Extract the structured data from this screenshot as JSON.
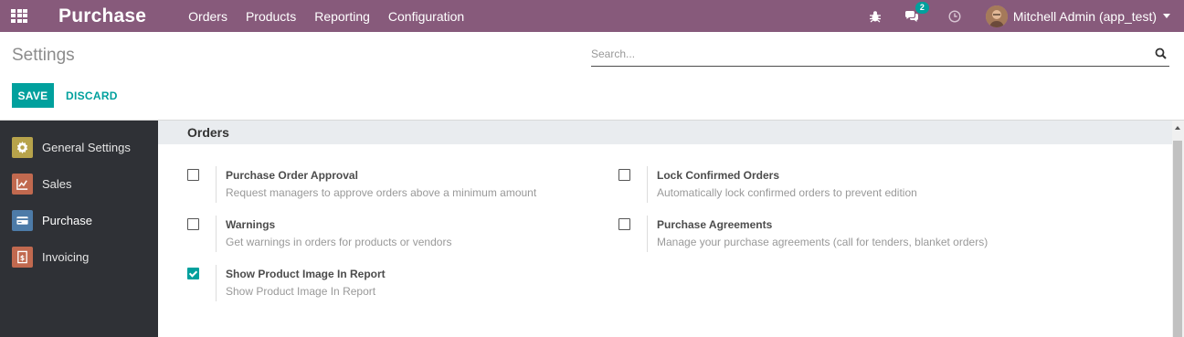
{
  "navbar": {
    "app_title": "Purchase",
    "menu": [
      "Orders",
      "Products",
      "Reporting",
      "Configuration"
    ],
    "chat_count": "2",
    "user_name": "Mitchell Admin (app_test)"
  },
  "control_panel": {
    "title": "Settings",
    "search_placeholder": "Search...",
    "save_label": "SAVE",
    "discard_label": "DISCARD"
  },
  "sidebar": {
    "items": [
      {
        "label": "General Settings",
        "icon": "gear-icon",
        "color": "#b7a34b"
      },
      {
        "label": "Sales",
        "icon": "sales-chart-icon",
        "color": "#c1694f"
      },
      {
        "label": "Purchase",
        "icon": "purchase-card-icon",
        "color": "#4d7ba8"
      },
      {
        "label": "Invoicing",
        "icon": "invoice-icon",
        "color": "#c1694f"
      }
    ],
    "active": "Purchase"
  },
  "section": {
    "title": "Orders",
    "settings": [
      {
        "title": "Purchase Order Approval",
        "description": "Request managers to approve orders above a minimum amount",
        "checked": false
      },
      {
        "title": "Lock Confirmed Orders",
        "description": "Automatically lock confirmed orders to prevent edition",
        "checked": false
      },
      {
        "title": "Warnings",
        "description": "Get warnings in orders for products or vendors",
        "checked": false
      },
      {
        "title": "Purchase Agreements",
        "description": "Manage your purchase agreements (call for tenders, blanket orders)",
        "checked": false
      },
      {
        "title": "Show Product Image In Report",
        "description": "Show Product Image In Report",
        "checked": true
      }
    ]
  },
  "colors": {
    "navbar": "#875a7b",
    "accent": "#00a09d",
    "sidebar": "#2f3136"
  }
}
